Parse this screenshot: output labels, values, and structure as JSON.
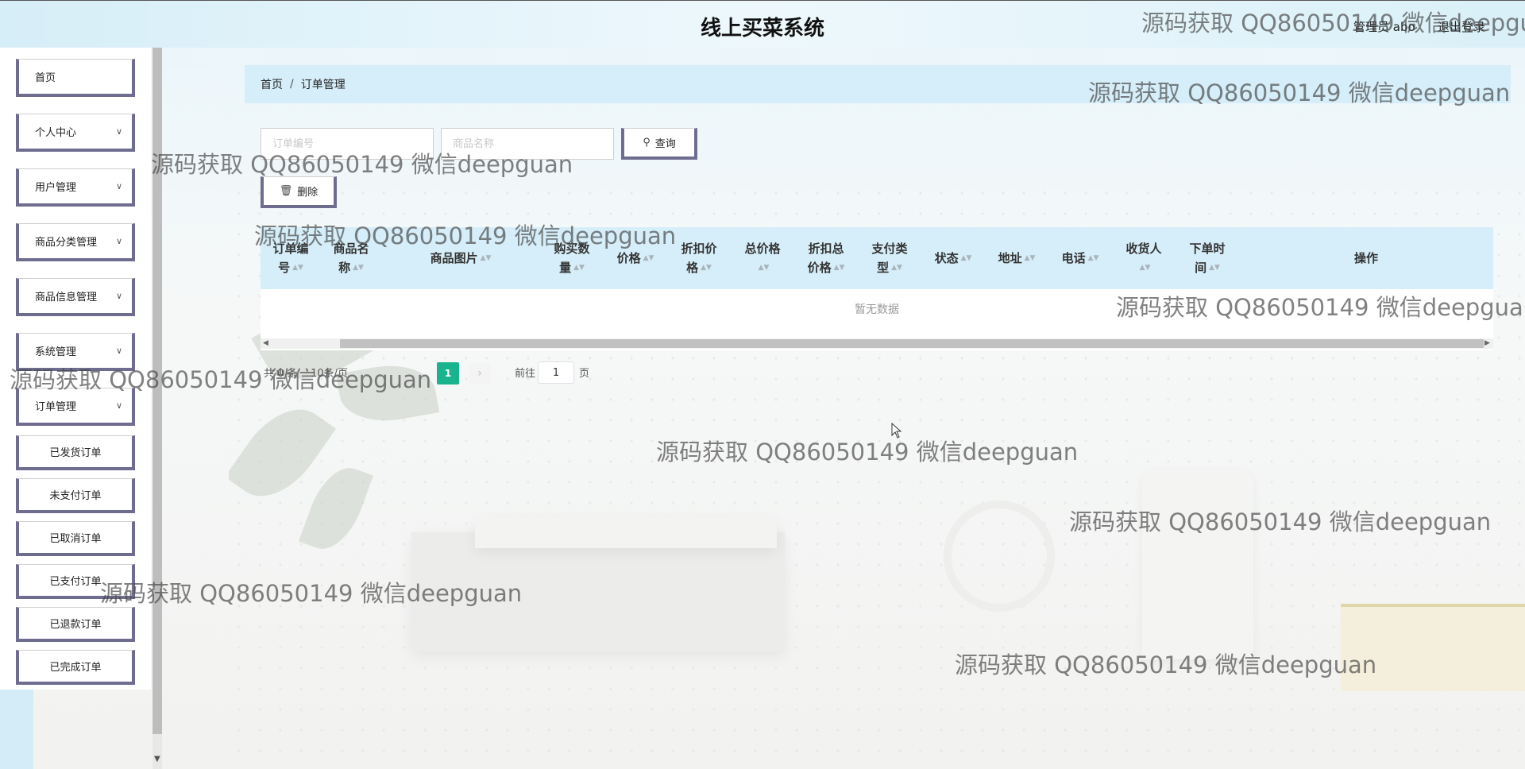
{
  "header": {
    "title": "线上买菜系统",
    "user": "管理员 abo",
    "logout": "退出登录"
  },
  "sidebar": {
    "items": [
      {
        "label": "首页",
        "expandable": false
      },
      {
        "label": "个人中心",
        "expandable": true
      },
      {
        "label": "用户管理",
        "expandable": true
      },
      {
        "label": "商品分类管理",
        "expandable": true
      },
      {
        "label": "商品信息管理",
        "expandable": true
      },
      {
        "label": "系统管理",
        "expandable": true
      },
      {
        "label": "订单管理",
        "expandable": true
      }
    ],
    "sub_items": [
      "已发货订单",
      "未支付订单",
      "已取消订单",
      "已支付订单",
      "已退款订单",
      "已完成订单"
    ]
  },
  "breadcrumb": {
    "home": "首页",
    "separator": "/",
    "current": "订单管理"
  },
  "search": {
    "order_no_placeholder": "订单编号",
    "product_name_placeholder": "商品名称",
    "query_label": "查询",
    "delete_label": "删除"
  },
  "table": {
    "columns": [
      {
        "line1": "订单编",
        "line2": "号"
      },
      {
        "line1": "商品名",
        "line2": "称"
      },
      {
        "line1": "商品图片",
        "line2": ""
      },
      {
        "line1": "购买数",
        "line2": "量"
      },
      {
        "line1": "价格",
        "line2": ""
      },
      {
        "line1": "折扣价",
        "line2": "格"
      },
      {
        "line1": "总价格",
        "line2": ""
      },
      {
        "line1": "折扣总",
        "line2": "价格"
      },
      {
        "line1": "支付类",
        "line2": "型"
      },
      {
        "line1": "状态",
        "line2": ""
      },
      {
        "line1": "地址",
        "line2": ""
      },
      {
        "line1": "电话",
        "line2": ""
      },
      {
        "line1": "收货人",
        "line2": ""
      },
      {
        "line1": "下单时",
        "line2": "间"
      },
      {
        "line1": "操作",
        "line2": ""
      }
    ],
    "empty_text": "暂无数据"
  },
  "pagination": {
    "total_text": "共 0 条",
    "page_size_text": "10条/页",
    "current_page": "1",
    "goto_label": "前往",
    "goto_value": "1",
    "goto_suffix": "页"
  },
  "watermark": "源码获取 QQ86050149 微信deepguan",
  "colors": {
    "accent_green": "#19b48e",
    "header_bg": "#d6eef9",
    "button_border": "#6f6d8f"
  }
}
